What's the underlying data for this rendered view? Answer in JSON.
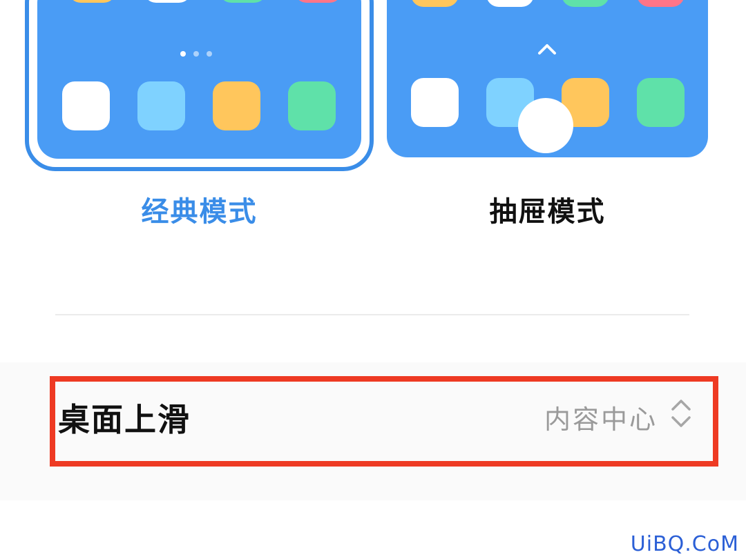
{
  "modes": {
    "classic": {
      "label": "经典模式",
      "selected": true,
      "accent_color": "#3a8de8",
      "screen_color": "#4a9cf5",
      "top_row_colors": [
        "#ffc65c",
        "#ffffff",
        "#5fe1a9",
        "#ff7588"
      ],
      "dock_colors": [
        "#ffffff",
        "#7fd2ff",
        "#ffc65c",
        "#5fe1a9"
      ],
      "page_dots": 3,
      "active_dot": 0
    },
    "drawer": {
      "label": "抽屉模式",
      "selected": false,
      "screen_color": "#4a9cf5",
      "top_row_colors": [
        "#ffc65c",
        "#ffffff",
        "#5fe1a9",
        "#ff7588"
      ],
      "dock_colors": [
        "#ffffff",
        "#7fd2ff",
        "#ffc65c",
        "#5fe1a9"
      ],
      "icons": [
        "chevron-up-icon",
        "swipe-circle"
      ]
    }
  },
  "setting": {
    "title": "桌面上滑",
    "value": "内容中心",
    "icon": "updown-chevron-icon",
    "highlight_color": "#ee3a23"
  },
  "watermark": "UiBQ.CoM"
}
